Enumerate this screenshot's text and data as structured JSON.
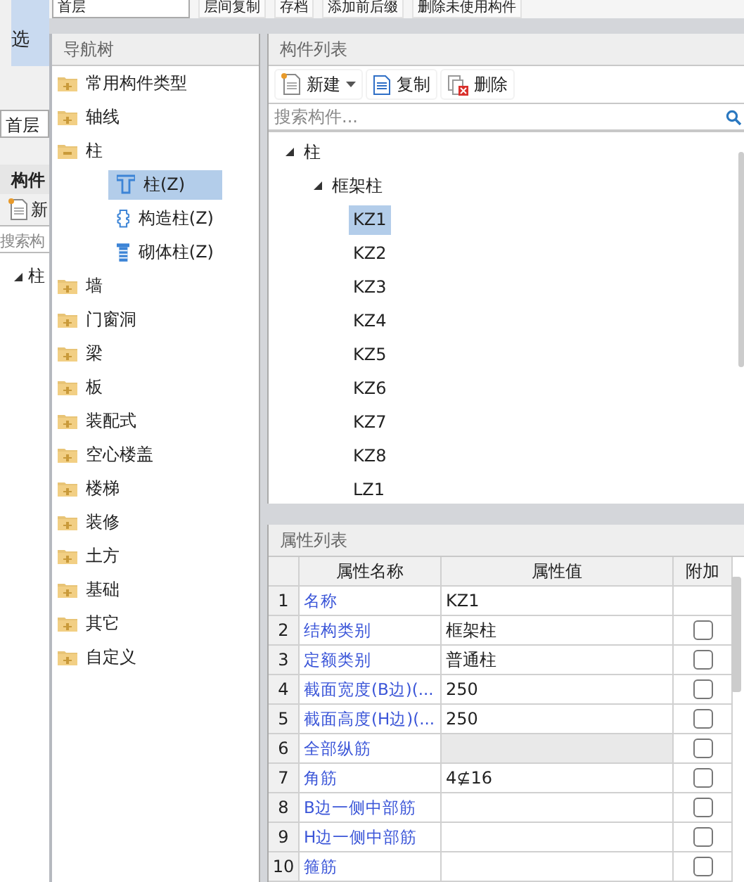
{
  "background": {
    "select_button": "选",
    "floor_field": "首层",
    "panel_title": "构件",
    "new_button": "新",
    "search_placeholder": "搜索构",
    "tree_root": "柱"
  },
  "toolbar": {
    "floor_dropdown": "首层",
    "buttons": [
      "层间复制",
      "存档",
      "添加前后缀",
      "删除未使用构件"
    ]
  },
  "navigation_tree": {
    "title": "导航树",
    "items": [
      {
        "label": "常用构件类型",
        "expanded": false
      },
      {
        "label": "轴线",
        "expanded": false
      },
      {
        "label": "柱",
        "expanded": true,
        "children": [
          {
            "label": "柱(Z)",
            "kind": "column",
            "selected": true
          },
          {
            "label": "构造柱(Z)",
            "kind": "structural-column",
            "selected": false
          },
          {
            "label": "砌体柱(Z)",
            "kind": "masonry-column",
            "selected": false
          }
        ]
      },
      {
        "label": "墙",
        "expanded": false
      },
      {
        "label": "门窗洞",
        "expanded": false
      },
      {
        "label": "梁",
        "expanded": false
      },
      {
        "label": "板",
        "expanded": false
      },
      {
        "label": "装配式",
        "expanded": false
      },
      {
        "label": "空心楼盖",
        "expanded": false
      },
      {
        "label": "楼梯",
        "expanded": false
      },
      {
        "label": "装修",
        "expanded": false
      },
      {
        "label": "土方",
        "expanded": false
      },
      {
        "label": "基础",
        "expanded": false
      },
      {
        "label": "其它",
        "expanded": false
      },
      {
        "label": "自定义",
        "expanded": false
      }
    ]
  },
  "component_list": {
    "title": "构件列表",
    "buttons": [
      {
        "label": "新建",
        "kind": "new"
      },
      {
        "label": "复制",
        "kind": "copy"
      },
      {
        "label": "删除",
        "kind": "delete"
      }
    ],
    "search_placeholder": "搜索构件...",
    "tree": [
      {
        "label": "柱",
        "expanded": true,
        "children": [
          {
            "label": "框架柱",
            "expanded": true,
            "children": [
              {
                "label": "KZ1",
                "selected": true
              },
              {
                "label": "KZ2",
                "selected": false
              },
              {
                "label": "KZ3",
                "selected": false
              },
              {
                "label": "KZ4",
                "selected": false
              },
              {
                "label": "KZ5",
                "selected": false
              },
              {
                "label": "KZ6",
                "selected": false
              },
              {
                "label": "KZ7",
                "selected": false
              },
              {
                "label": "KZ8",
                "selected": false
              },
              {
                "label": "LZ1",
                "selected": false
              }
            ]
          }
        ]
      }
    ]
  },
  "property_list": {
    "title": "属性列表",
    "columns": [
      "属性名称",
      "属性值",
      "附加"
    ],
    "rows": [
      {
        "number": "1",
        "name": "名称",
        "value": "KZ1"
      },
      {
        "number": "2",
        "name": "结构类别",
        "value": "框架柱",
        "checked": false
      },
      {
        "number": "3",
        "name": "定额类别",
        "value": "普通柱",
        "checked": false
      },
      {
        "number": "4",
        "name": "截面宽度(B边)(...",
        "value": "250",
        "checked": false
      },
      {
        "number": "5",
        "name": "截面高度(H边)(...",
        "value": "250",
        "checked": false
      },
      {
        "number": "6",
        "name": "全部纵筋",
        "value": "",
        "kind": "readonly",
        "checked": false
      },
      {
        "number": "7",
        "name": "角筋",
        "value": "4⊈16",
        "checked": false
      },
      {
        "number": "8",
        "name": "B边一侧中部筋",
        "value": "",
        "checked": false
      },
      {
        "number": "9",
        "name": "H边一侧中部筋",
        "value": "",
        "checked": false
      },
      {
        "number": "10",
        "name": "箍筋",
        "value": "",
        "checked": false
      }
    ]
  }
}
